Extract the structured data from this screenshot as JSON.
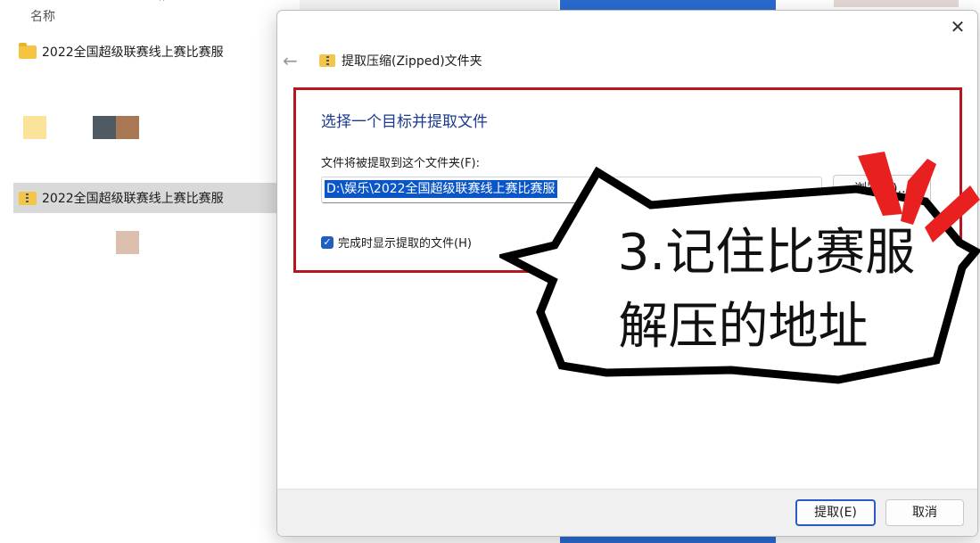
{
  "explorer": {
    "column_header": "名称",
    "rows": [
      {
        "name": "2022全国超级联赛线上赛比赛服",
        "type": "folder"
      },
      {
        "name": "2022全国超级联赛线上赛比赛服",
        "type": "zip"
      }
    ]
  },
  "dialog": {
    "nav_title": "提取压缩(Zipped)文件夹",
    "heading": "选择一个目标并提取文件",
    "path_label": "文件将被提取到这个文件夹(F):",
    "path_value": "D:\\娱乐\\2022全国超级联赛线上赛比赛服",
    "browse_label": "浏览(R)...",
    "show_files_label": "完成时显示提取的文件(H)",
    "show_files_checked": true,
    "extract_label": "提取(E)",
    "cancel_label": "取消"
  },
  "annotation": {
    "line1": "3.记住比赛服",
    "line2": "解压的地址",
    "bubble_color": "#ffffff",
    "spark_color": "#e82020"
  },
  "colors": {
    "highlight_border": "#b5171c",
    "heading": "#1b3a8c",
    "selection": "#0a56c9"
  }
}
